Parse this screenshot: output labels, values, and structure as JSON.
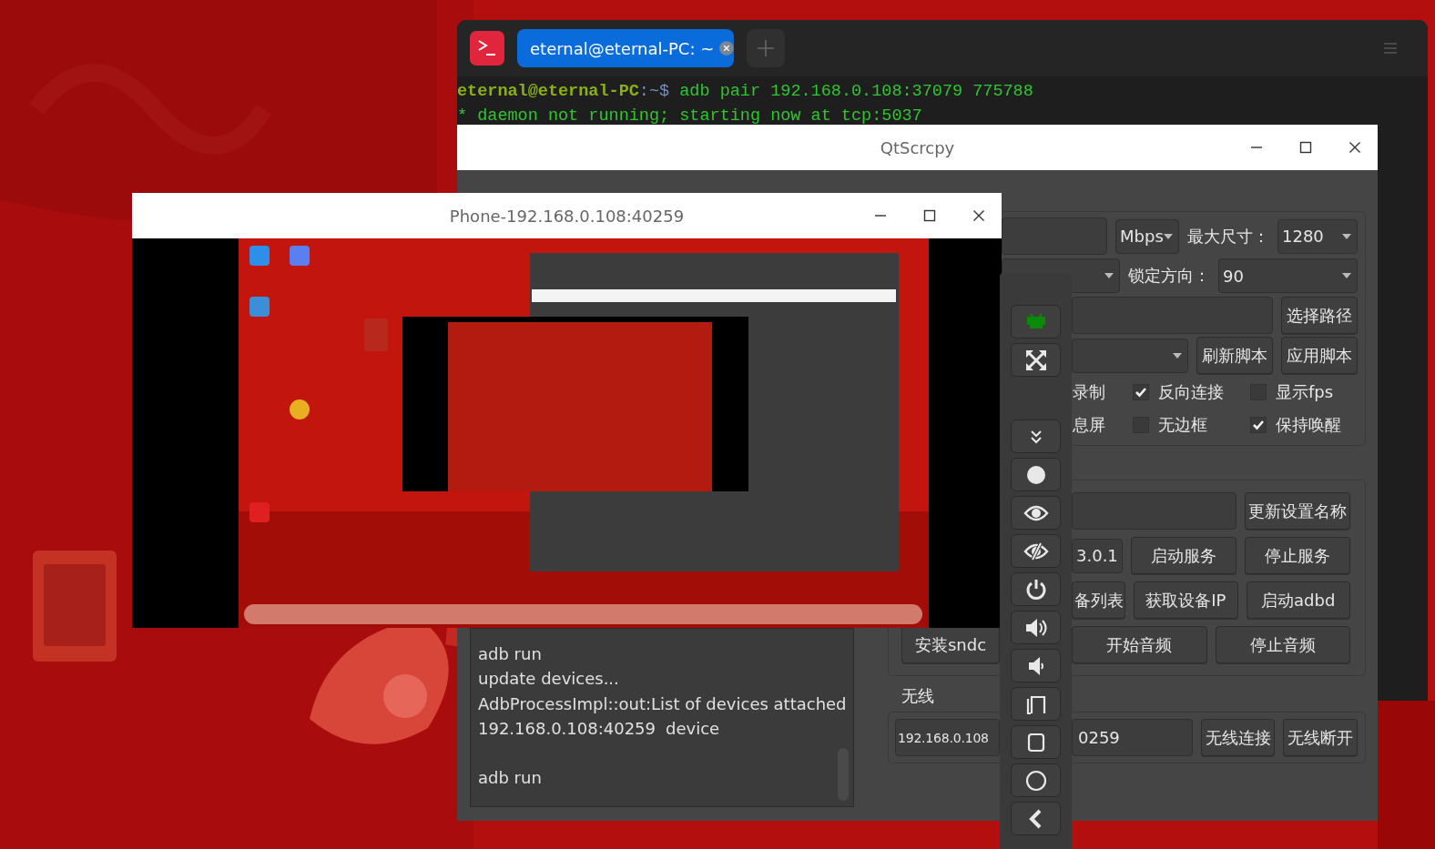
{
  "terminal": {
    "tabs": [
      {
        "title": "eternal@eternal-PC: ~",
        "selected": true
      }
    ],
    "lines": [
      {
        "kind": "prompt",
        "user": "eternal@eternal-PC",
        "path": ":~$",
        "command": " adb pair 192.168.0.108:37079 775788"
      },
      {
        "kind": "output",
        "text": "* daemon not running; starting now at tcp:5037"
      }
    ]
  },
  "qtscrcpy": {
    "title": "QtScrcpy",
    "groups": [
      {
        "rows": [
          {
            "items": [
              {
                "kind": "field"
              },
              {
                "kind": "dropdown",
                "value": "Mbps"
              },
              {
                "kind": "label",
                "text": "最大尺寸："
              },
              {
                "kind": "dropdown",
                "value": "1280"
              }
            ]
          },
          {
            "items": [
              {
                "kind": "dropdown"
              },
              {
                "kind": "label",
                "text": "锁定方向："
              },
              {
                "kind": "dropdown",
                "value": "90"
              }
            ]
          },
          {
            "items": [
              {
                "kind": "field"
              },
              {
                "kind": "button",
                "text": "选择路径"
              }
            ]
          },
          {
            "items": [
              {
                "kind": "dropdown"
              },
              {
                "kind": "button",
                "text": "刷新脚本"
              },
              {
                "kind": "button",
                "text": "应用脚本"
              }
            ]
          },
          {
            "items": [
              {
                "kind": "label",
                "text": "录制"
              },
              {
                "kind": "checkbox",
                "text": "反向连接",
                "checked": true
              },
              {
                "kind": "checkbox",
                "text": "显示fps",
                "checked": false
              }
            ]
          },
          {
            "items": [
              {
                "kind": "label",
                "text": "息屏"
              },
              {
                "kind": "checkbox",
                "text": "无边框",
                "checked": false
              },
              {
                "kind": "checkbox",
                "text": "保持唤醒",
                "checked": true
              }
            ]
          }
        ]
      },
      {
        "rows": [
          {
            "items": [
              {
                "kind": "field"
              },
              {
                "kind": "button",
                "text": "更新设置名称"
              }
            ]
          },
          {
            "items": [
              {
                "kind": "dropdown",
                "value": "3.0.1"
              },
              {
                "kind": "button",
                "text": "启动服务"
              },
              {
                "kind": "button",
                "text": "停止服务"
              }
            ]
          },
          {
            "items": [
              {
                "kind": "button",
                "text": "备列表"
              },
              {
                "kind": "button",
                "text": "获取设备IP"
              },
              {
                "kind": "button",
                "text": "启动adbd"
              }
            ]
          },
          {
            "left": [
              {
                "kind": "button",
                "text": "安装sndc"
              }
            ],
            "items": [
              {
                "kind": "button",
                "text": "开始音频"
              },
              {
                "kind": "button",
                "text": "停止音频"
              }
            ]
          }
        ]
      },
      {
        "label": "无线",
        "rows": [
          {
            "left": [
              {
                "kind": "field",
                "value": "192.168.0.108"
              }
            ],
            "items": [
              {
                "kind": "field",
                "value": "0259"
              },
              {
                "kind": "button",
                "text": "无线连接"
              },
              {
                "kind": "button",
                "text": "无线断开"
              }
            ]
          }
        ]
      }
    ],
    "log": [
      [
        "adb run",
        "update devices...",
        "AdbProcessImpl::out:List of devices attached",
        "192.168.0.108:40259\tdevice"
      ],
      [
        "adb run"
      ]
    ]
  },
  "phone_window": {
    "title": "Phone-192.168.0.108:40259"
  }
}
